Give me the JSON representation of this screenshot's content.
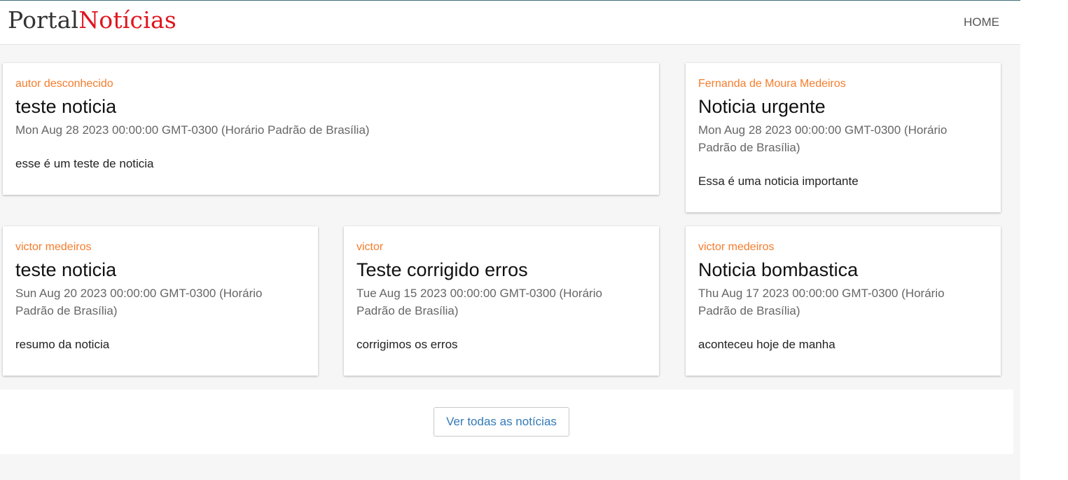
{
  "header": {
    "logo_part1": "Portal",
    "logo_part2": "Notícias",
    "nav_home": "HOME"
  },
  "cards": [
    {
      "author": "autor desconhecido",
      "title": "teste noticia",
      "date": "Mon Aug 28 2023 00:00:00 GMT-0300 (Horário Padrão de Brasília)",
      "summary": "esse é um teste de noticia"
    },
    {
      "author": "Fernanda de Moura Medeiros",
      "title": "Noticia urgente",
      "date": "Mon Aug 28 2023 00:00:00 GMT-0300 (Horário Padrão de Brasília)",
      "summary": "Essa é uma noticia importante"
    },
    {
      "author": "victor medeiros",
      "title": "teste noticia",
      "date": "Sun Aug 20 2023 00:00:00 GMT-0300 (Horário Padrão de Brasília)",
      "summary": "resumo da noticia"
    },
    {
      "author": "victor",
      "title": "Teste corrigido erros",
      "date": "Tue Aug 15 2023 00:00:00 GMT-0300 (Horário Padrão de Brasília)",
      "summary": "corrigimos os erros"
    },
    {
      "author": "victor medeiros",
      "title": "Noticia bombastica",
      "date": "Thu Aug 17 2023 00:00:00 GMT-0300 (Horário Padrão de Brasília)",
      "summary": "aconteceu hoje de manha"
    }
  ],
  "footer": {
    "see_all_label": "Ver todas as notícias"
  },
  "colors": {
    "author": "#f57c2c",
    "logo_accent": "#e0151f",
    "button_text": "#337ab7"
  }
}
